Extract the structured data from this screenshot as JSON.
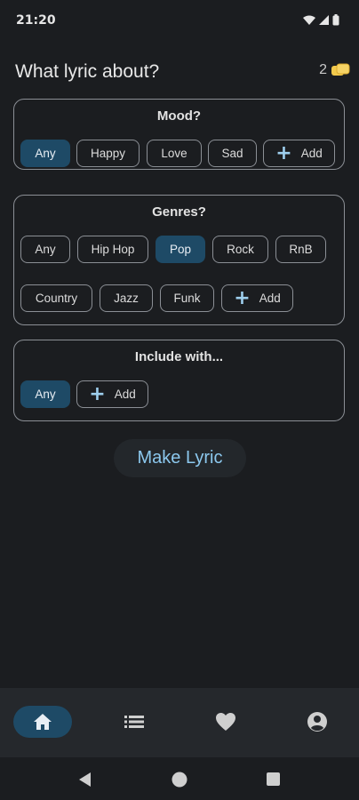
{
  "status": {
    "time": "21:20"
  },
  "header": {
    "title": "What lyric about?",
    "coins": "2"
  },
  "mood": {
    "title": "Mood?",
    "chips": [
      "Any",
      "Happy",
      "Love",
      "Sad"
    ],
    "add_label": "Add"
  },
  "genres": {
    "title": "Genres?",
    "chips": [
      "Any",
      "Hip Hop",
      "Pop",
      "Rock",
      "RnB",
      "Country",
      "Jazz",
      "Funk"
    ],
    "add_label": "Add"
  },
  "include": {
    "title": "Include with...",
    "chips": [
      "Any"
    ],
    "add_label": "Add"
  },
  "make_button": "Make Lyric",
  "colors": {
    "accent": "#1e4a66",
    "accent_text": "#8cc8ee",
    "background": "#1b1d20"
  },
  "nav": {
    "items": [
      "home-icon",
      "list-icon",
      "heart-icon",
      "account-icon"
    ],
    "active": "home-icon"
  }
}
